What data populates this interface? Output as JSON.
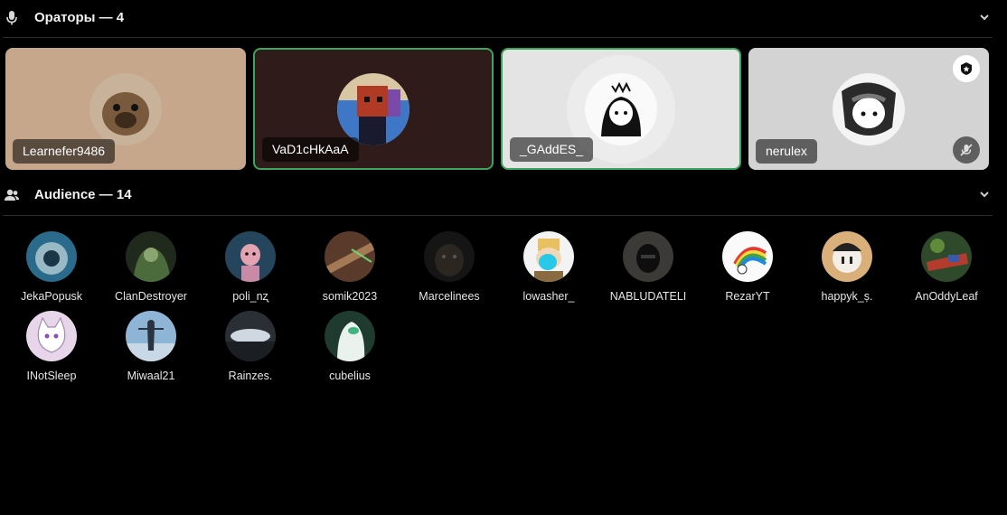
{
  "speakers_section": {
    "title": "Ораторы — 4",
    "icon": "microphone-icon",
    "speakers": [
      {
        "name": "Learnefer9486",
        "speaking": false,
        "bg": "#c7a78c"
      },
      {
        "name": "VaD1cHkAaA",
        "speaking": true,
        "bg": "#2e1b1a"
      },
      {
        "name": "_GAddES_",
        "speaking": true,
        "bg": "#e4e4e4"
      },
      {
        "name": "nerulex",
        "speaking": false,
        "bg": "#d3d3d3",
        "moderator_badge": true,
        "muted": true
      }
    ]
  },
  "audience_section": {
    "title": "Audience — 14",
    "icon": "users-icon",
    "members": [
      "JekaPopusk",
      "ClanDestroyer",
      "poli_nʐ",
      "somik2023",
      "Marcelinees",
      "lowasher_",
      "NABLUDATELI",
      "RezarYT",
      "happyk_ș.",
      "AnOddyLeaf",
      "INotSleep",
      "Miwaal21",
      "Rainzes.",
      "cubelius"
    ]
  },
  "colors": {
    "background": "#000000",
    "speaking_border": "#3ba55c",
    "divider": "#2b2b2e"
  }
}
